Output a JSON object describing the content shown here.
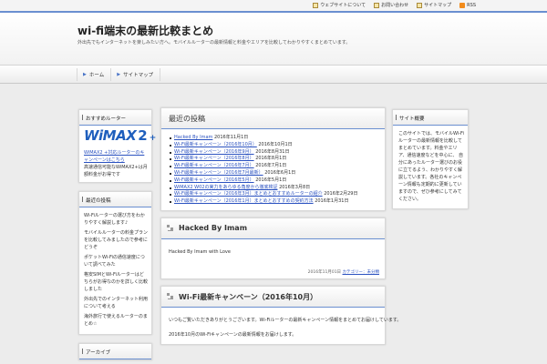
{
  "top_links": {
    "link1": "ウェブサイトについて",
    "link2": "お問い合わせ",
    "link3": "サイトマップ",
    "rss": "RSS"
  },
  "site": {
    "title": "wi-fi端末の最新比較まとめ",
    "description": "外出先でもインターネットを楽しみたい方へ。モバイルルーターの最新情報と料金やエリアを比較してわかりやすくまとめています。"
  },
  "nav": {
    "home": "ホーム",
    "sitemap": "サイトマップ"
  },
  "left_widgets": {
    "ad": {
      "title": "おすすめルーター",
      "logo_text": "WiMAX",
      "logo_num": "2",
      "logo_plus": "+",
      "link_text": "WiMAX2 +対応ルーターのキャンペーンはこちら",
      "desc": "高速通信可能なWiMAX2+は月額料金がお得です"
    },
    "recent": {
      "title": "最近の投稿",
      "items": [
        "Wi-Fiルーターの選び方をわかりやすく解説します♪",
        "モバイルルーターの料金プランを比較してみましたので参考にどうぞ",
        "ポケットWi-Fiの通信速度について調べてみた",
        "格安SIMとWi-Fiルーターはどちらがお得なのかを詳しく比較しました",
        "外出先でのインターネット利用について考える",
        "海外旅行で使えるルーターのまとめ☆"
      ]
    },
    "third": {
      "title": "アーカイブ"
    }
  },
  "archive_post": {
    "title": "最近の投稿",
    "items": [
      {
        "link": "Hacked By Imam",
        "date": "2016年11月1日"
      },
      {
        "link": "Wi-Fi最新キャンペーン（2016年10月）",
        "date": "2016年10月1日"
      },
      {
        "link": "Wi-Fi最新キャンペーン（2016年9月）",
        "date": "2016年8月31日"
      },
      {
        "link": "Wi-Fi最新キャンペーン（2016年8月）",
        "date": "2016年8月1日"
      },
      {
        "link": "Wi-Fi最新キャンペーン（2016年7月）",
        "date": "2016年7月1日"
      },
      {
        "link": "Wi-Fi最新キャンペーン（2016年7月最新）",
        "date": "2016年6月1日"
      },
      {
        "link": "Wi-Fi最新キャンペーン（2016年5月）",
        "date": "2016年5月1日"
      },
      {
        "link": "WiMAX2 W02の実力をあらゆる角度から徹底検証",
        "date": "2016年3月8日"
      },
      {
        "link": "Wi-Fi最新キャンペーン（2016年3月）まとめとおすすめルーターの紹介",
        "date": "2016年2月29日"
      },
      {
        "link": "Wi-Fi最新キャンペーン（2016年1月）まとめとおすすめの契約方法",
        "date": "2016年1月31日"
      }
    ]
  },
  "post1": {
    "title": "Hacked By Imam",
    "body": "Hacked By Imam with Love",
    "meta_date": "2016年11月01日",
    "meta_category": "カテゴリー：未分類"
  },
  "post2": {
    "title": "Wi-Fi最新キャンペーン（2016年10月）",
    "line1": "いつもご覧いただきありがとうございます。Wi-Fiルーターの最新キャンペーン情報をまとめてお届けしています。",
    "line2": "2016年10月のWi-Fiキャンペーンの最新情報をお届けします。"
  },
  "right_widget": {
    "title": "サイト概要",
    "body": "このサイトでは、モバイルWi-Fiルーターの最新情報を比較してまとめています。料金やエリア、通信速度などを中心に、 自分にあったルーター選びのお役に立てるよう、わかりやすく解説しています。各社のキャンペーン情報も定期的に更新していますので、ぜひ参考にしてみてください。"
  }
}
